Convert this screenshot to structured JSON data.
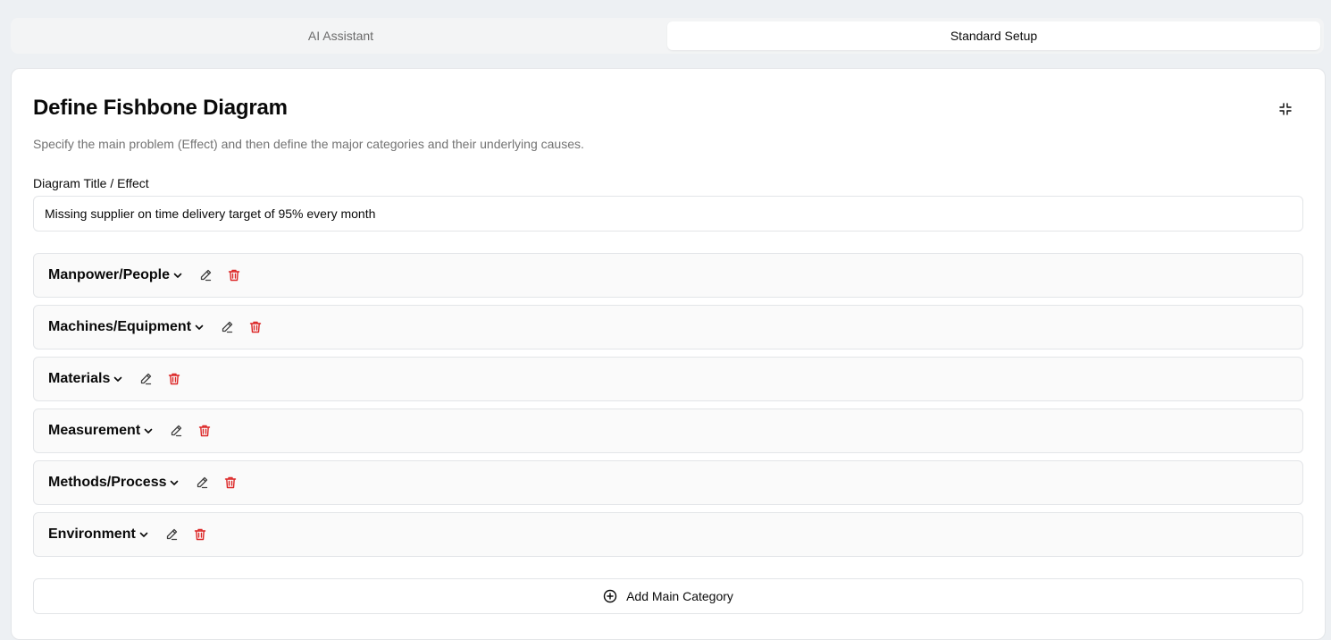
{
  "tabs": [
    {
      "label": "AI Assistant",
      "active": false
    },
    {
      "label": "Standard Setup",
      "active": true
    }
  ],
  "card": {
    "title": "Define Fishbone Diagram",
    "description": "Specify the main problem (Effect) and then define the major categories and their underlying causes.",
    "collapse_icon": "minimize-icon"
  },
  "effect_field": {
    "label": "Diagram Title / Effect",
    "value": "Missing supplier on time delivery target of 95% every month"
  },
  "categories": [
    {
      "name": "Manpower/People"
    },
    {
      "name": "Machines/Equipment"
    },
    {
      "name": "Materials"
    },
    {
      "name": "Measurement"
    },
    {
      "name": "Methods/Process"
    },
    {
      "name": "Environment"
    }
  ],
  "add_button": {
    "label": "Add Main Category",
    "icon": "plus-circle-icon"
  },
  "colors": {
    "delete": "#dc2626",
    "border": "#e3e5e8",
    "muted_text": "#737373"
  }
}
